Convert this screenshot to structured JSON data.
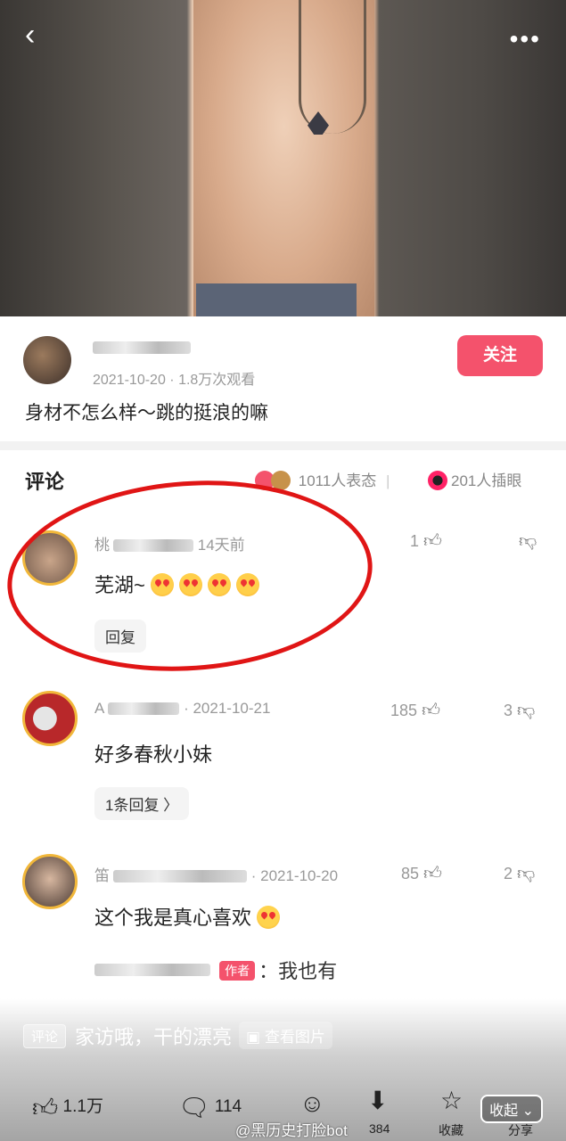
{
  "author": {
    "date": "2021-10-20",
    "views": "1.8万次观看",
    "follow_label": "关注",
    "description": "身材不怎么样～跳的挺浪的嘛"
  },
  "comments_header": {
    "title": "评论",
    "reactions": "1011人表态",
    "sep": "|",
    "insert_count": "201人插眼"
  },
  "comments": [
    {
      "name_prefix": "桃",
      "time": "14天前",
      "likes": "1",
      "text": "芜湖~",
      "reply_label": "回复",
      "emojis": 4
    },
    {
      "name_prefix": "A",
      "time": "· 2021-10-21",
      "likes": "185",
      "dislikes": "3",
      "text": "好多春秋小妹",
      "reply_label": "1条回复 〉"
    },
    {
      "name_prefix": "笛",
      "time": "· 2021-10-20",
      "likes": "85",
      "dislikes": "2",
      "text": "这个我是真心喜欢"
    }
  ],
  "sub_reply": {
    "author_tag": "作者",
    "text": "：我也有"
  },
  "danmaku": {
    "tag": "评论",
    "text": "家访哦，干的漂亮",
    "view_images": "查看图片"
  },
  "bottom_bar": {
    "likes": "1.1万",
    "comments": "114",
    "downloads": "384",
    "favorites": "收藏",
    "share": "分享",
    "collapse": "收起"
  },
  "watermark": "@黑历史打脸bot"
}
